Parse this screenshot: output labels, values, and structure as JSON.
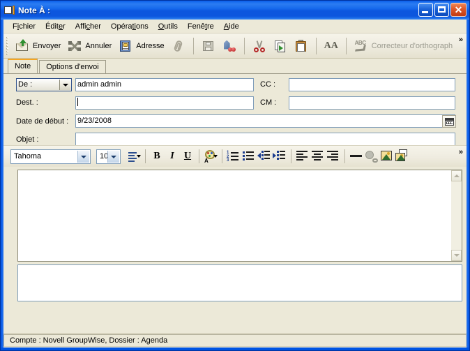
{
  "window": {
    "title": "Note À :",
    "icon": "note-icon",
    "buttons": {
      "minimize": "minimize-button",
      "maximize": "maximize-button",
      "close": "close-button",
      "close_glyph": "✕"
    }
  },
  "menubar": {
    "items": [
      {
        "label": "Fichier",
        "pre": "F",
        "key": "i",
        "post": "chier"
      },
      {
        "label": "Éditer",
        "pre": "Édit",
        "key": "e",
        "post": "r"
      },
      {
        "label": "Afficher",
        "pre": "Affi",
        "key": "c",
        "post": "her"
      },
      {
        "label": "Opérations",
        "pre": "Opéra",
        "key": "ti",
        "post": "ons"
      },
      {
        "label": "Outils",
        "pre": "",
        "key": "O",
        "post": "utils"
      },
      {
        "label": "Fenêtre",
        "pre": "Fenê",
        "key": "t",
        "post": "re"
      },
      {
        "label": "Aide",
        "pre": "",
        "key": "A",
        "post": "ide"
      }
    ]
  },
  "toolbar": {
    "send_label": "Envoyer",
    "cancel_label": "Annuler",
    "address_label": "Adresse",
    "attach_label": "",
    "save_label": "",
    "priority_label": "",
    "cut_label": "",
    "copy_label": "",
    "paste_label": "",
    "font_label": "",
    "spellcheck_label": "Correcteur d'orthograph",
    "overflow_glyph": "»"
  },
  "tabs": [
    {
      "label": "Note",
      "active": true
    },
    {
      "label": "Options d'envoi",
      "active": false
    }
  ],
  "form": {
    "from_label": "De :",
    "from_value": "admin admin",
    "to_label": "Dest. :",
    "to_value": "",
    "cc_label": "CC :",
    "cc_value": "",
    "bcc_label": "CM :",
    "bcc_value": "",
    "startdate_label": "Date de début :",
    "startdate_value": "9/23/2008",
    "subject_label": "Objet :",
    "subject_value": "",
    "calendar_button": "calendar-picker-button"
  },
  "format_toolbar": {
    "font_family": "Tahoma",
    "font_size": "10",
    "bold_label": "B",
    "italic_label": "I",
    "underline_label": "U",
    "font_icon_label": "AA",
    "overflow_glyph": "»"
  },
  "body": {
    "text": "",
    "scrollbar": "vertical-scrollbar"
  },
  "attachments": {
    "items": []
  },
  "statusbar": {
    "text": "Compte : Novell GroupWise,  Dossier : Agenda"
  },
  "colors": {
    "titlebar_blue": "#0054e3",
    "face": "#ece9d8",
    "accent_orange": "#f5a623",
    "field_border": "#7f9db9"
  }
}
